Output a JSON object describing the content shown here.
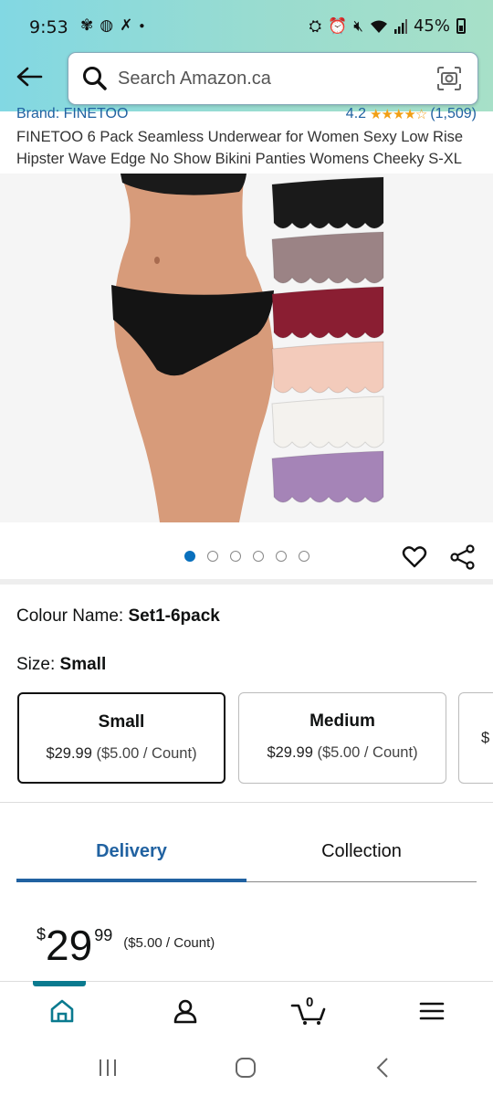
{
  "status_bar": {
    "time": "9:53",
    "battery": "45%",
    "left_icons": [
      "pinwheel-icon",
      "basketball-icon",
      "x-icon",
      "dot-icon"
    ],
    "right_icons": [
      "lock-icon",
      "alarm-icon",
      "mute-icon",
      "wifi-icon",
      "signal-icon"
    ]
  },
  "header": {
    "search_placeholder": "Search Amazon.ca"
  },
  "product": {
    "brand": "Brand: FINETOO",
    "rating": "4.2",
    "rating_count": "(1,509)",
    "stars": "★★★★☆",
    "title": "FINETOO 6 Pack Seamless Underwear for Women Sexy Low Rise Hipster Wave Edge No Show Bikini Panties Womens Cheeky S-XL",
    "image_count": 6,
    "active_image": 1,
    "colour_label": "Colour Name: ",
    "colour_value": "Set1-6pack",
    "size_label": "Size: ",
    "size_value": "Small",
    "sizes": [
      {
        "name": "Small",
        "price": "$29.99",
        "unit": "($5.00 / Count)"
      },
      {
        "name": "Medium",
        "price": "$29.99",
        "unit": "($5.00 / Count)"
      },
      {
        "name": "",
        "price": "$",
        "unit": ""
      }
    ],
    "panty_colors": [
      "#1a1a1a",
      "#9b8385",
      "#8a1e32",
      "#f3cbbb",
      "#f4f2ee",
      "#a584b7"
    ]
  },
  "tabs": {
    "delivery": "Delivery",
    "collection": "Collection"
  },
  "price": {
    "symbol": "$",
    "whole": "29",
    "fraction": "99",
    "per_unit": "($5.00 / Count)"
  },
  "bottom_nav": {
    "cart_count": "0"
  },
  "colors": {
    "accent": "#2162a1",
    "teal": "#0a7a8f",
    "star": "#f19f15"
  }
}
